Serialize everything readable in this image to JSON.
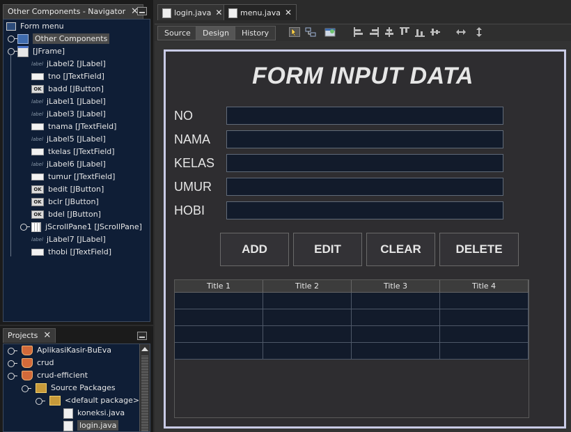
{
  "navigator": {
    "tab_title": "Other Components - Navigator",
    "close_glyph": "✕",
    "root_label": "Form menu",
    "other_components": "Other Components",
    "jframe": "[JFrame]",
    "components": [
      {
        "label": "jLabel2 [JLabel]",
        "kind": "label"
      },
      {
        "label": "tno [JTextField]",
        "kind": "field"
      },
      {
        "label": "badd [JButton]",
        "kind": "button"
      },
      {
        "label": "jLabel1 [JLabel]",
        "kind": "label"
      },
      {
        "label": "jLabel3 [JLabel]",
        "kind": "label"
      },
      {
        "label": "tnama [JTextField]",
        "kind": "field"
      },
      {
        "label": "jLabel5 [JLabel]",
        "kind": "label"
      },
      {
        "label": "tkelas [JTextField]",
        "kind": "field"
      },
      {
        "label": "jLabel6 [JLabel]",
        "kind": "label"
      },
      {
        "label": "tumur [JTextField]",
        "kind": "field"
      },
      {
        "label": "bedit [JButton]",
        "kind": "button"
      },
      {
        "label": "bclr [JButton]",
        "kind": "button"
      },
      {
        "label": "bdel [JButton]",
        "kind": "button"
      },
      {
        "label": "jScrollPane1 [JScrollPane]",
        "kind": "scroll"
      },
      {
        "label": "jLabel7 [JLabel]",
        "kind": "label"
      },
      {
        "label": "thobi [JTextField]",
        "kind": "field"
      }
    ],
    "icon_texts": {
      "label": "label",
      "button": "OK"
    }
  },
  "projects": {
    "tab_title": "Projects",
    "close_glyph": "✕",
    "items": [
      {
        "label": "AplikasiKasir-BuEva",
        "icon": "coffee-icon"
      },
      {
        "label": "crud",
        "icon": "coffee-icon"
      },
      {
        "label": "crud-efficient",
        "icon": "coffee-icon"
      },
      {
        "label": "Source Packages",
        "icon": "package-folder-icon"
      },
      {
        "label": "<default package>",
        "icon": "package-icon"
      },
      {
        "label": "koneksi.java",
        "icon": "java-file-icon"
      },
      {
        "label": "login.java",
        "icon": "java-file-icon"
      }
    ]
  },
  "editor": {
    "tabs": [
      {
        "label": "login.java",
        "active": false
      },
      {
        "label": "menu.java",
        "active": true
      }
    ],
    "close_glyph": "✕",
    "view_buttons": {
      "source": "Source",
      "design": "Design",
      "history": "History"
    }
  },
  "form": {
    "title": "FORM INPUT DATA",
    "labels": [
      "NO",
      "NAMA",
      "KELAS",
      "UMUR",
      "HOBI"
    ],
    "buttons": [
      "ADD",
      "EDIT",
      "CLEAR",
      "DELETE"
    ],
    "table": {
      "columns": [
        "Title 1",
        "Title 2",
        "Title 3",
        "Title 4"
      ],
      "rows": 4
    }
  },
  "colors": {
    "panel_bg": "#0f1e36",
    "field_bg": "#121b2b",
    "form_bg": "#2e2d30",
    "frame_border": "#c9cbe6"
  }
}
